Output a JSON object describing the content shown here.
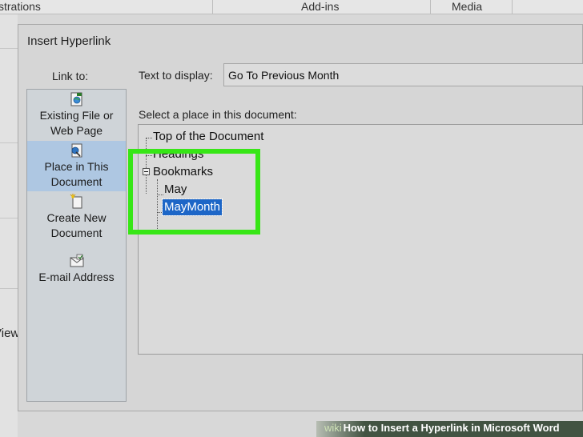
{
  "ribbon": {
    "groups": [
      "strations",
      "Add-ins",
      "Media"
    ]
  },
  "background": {
    "view_partial": "View"
  },
  "dialog": {
    "title": "Insert Hyperlink",
    "link_to_label": "Link to:",
    "link_items": [
      {
        "label_line1": "Existing File or",
        "label_line2": "Web Page",
        "icon": "existing-file-icon"
      },
      {
        "label_line1": "Place in This",
        "label_line2": "Document",
        "icon": "place-in-document-icon",
        "selected": true
      },
      {
        "label_line1": "Create New",
        "label_line2": "Document",
        "icon": "create-new-document-icon"
      },
      {
        "label_line1": "E-mail Address",
        "label_line2": "",
        "icon": "email-address-icon"
      }
    ],
    "text_to_display_label": "Text to display:",
    "text_to_display_value": "Go To Previous Month",
    "select_place_label": "Select a place in this document:",
    "tree": {
      "top_of_document": "Top of the Document",
      "headings": "Headings",
      "bookmarks": "Bookmarks",
      "bookmark_items": [
        "May",
        "MayMonth"
      ],
      "selected": "MayMonth"
    }
  },
  "highlight_color": "#37e616",
  "selection_color": "#1d66c7",
  "watermark": {
    "wiki": "wiki",
    "text": "How to Insert a Hyperlink in Microsoft Word"
  }
}
